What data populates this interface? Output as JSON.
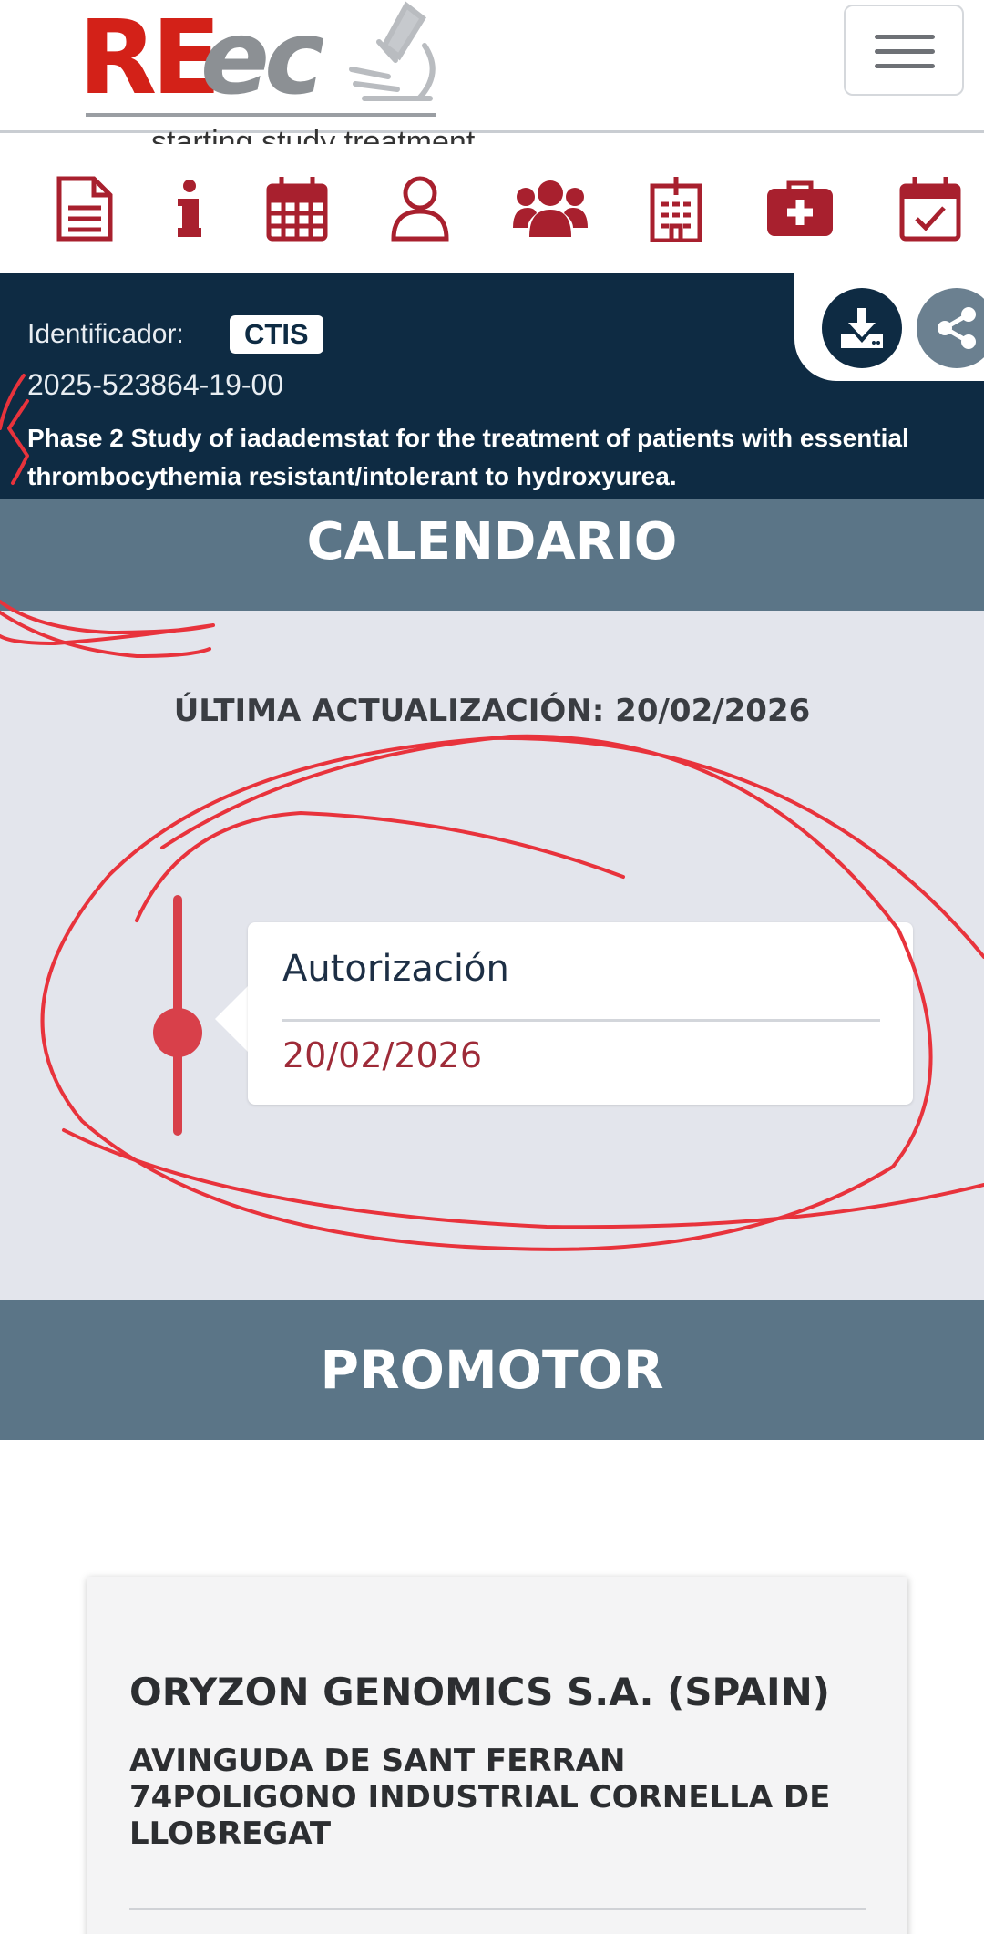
{
  "header": {
    "logo_text_re": "RE",
    "logo_text_ec": "ec",
    "menu_icon": "hamburger-icon",
    "overlapping_text": "starting study treatment"
  },
  "nav_icons": [
    {
      "name": "document-icon"
    },
    {
      "name": "info-icon",
      "glyph": "i"
    },
    {
      "name": "calendar-grid-icon"
    },
    {
      "name": "user-icon"
    },
    {
      "name": "users-group-icon"
    },
    {
      "name": "hospital-icon"
    },
    {
      "name": "medkit-icon"
    },
    {
      "name": "calendar-check-icon"
    }
  ],
  "study": {
    "id_label": "Identificador:",
    "badge": "CTIS",
    "id_value": "2025-523864-19-00",
    "title": "Phase 2 Study of iadademstat for the treatment of patients with essential thrombocythemia resistant/intolerant to hydroxyurea.",
    "download_icon": "download-icon",
    "share_icon": "share-icon"
  },
  "calendar": {
    "header": "CALENDARIO",
    "last_update": "ÚLTIMA ACTUALIZACIÓN: 20/02/2026",
    "events": [
      {
        "label": "Autorización",
        "date": "20/02/2026"
      }
    ]
  },
  "promotor": {
    "header": "PROMOTOR",
    "name": "ORYZON GENOMICS S.A. (SPAIN)",
    "address": "AVINGUDA DE SANT FERRAN 74POLIGONO INDUSTRIAL CORNELLA DE LLOBREGAT"
  },
  "colors": {
    "brand_red": "#d32118",
    "nav_icon_red": "#a8202e",
    "dark_navy": "#0e2b43",
    "section_slate": "#5b7587",
    "timeline_red": "#d8404a",
    "annotation_red": "#e8333c"
  }
}
